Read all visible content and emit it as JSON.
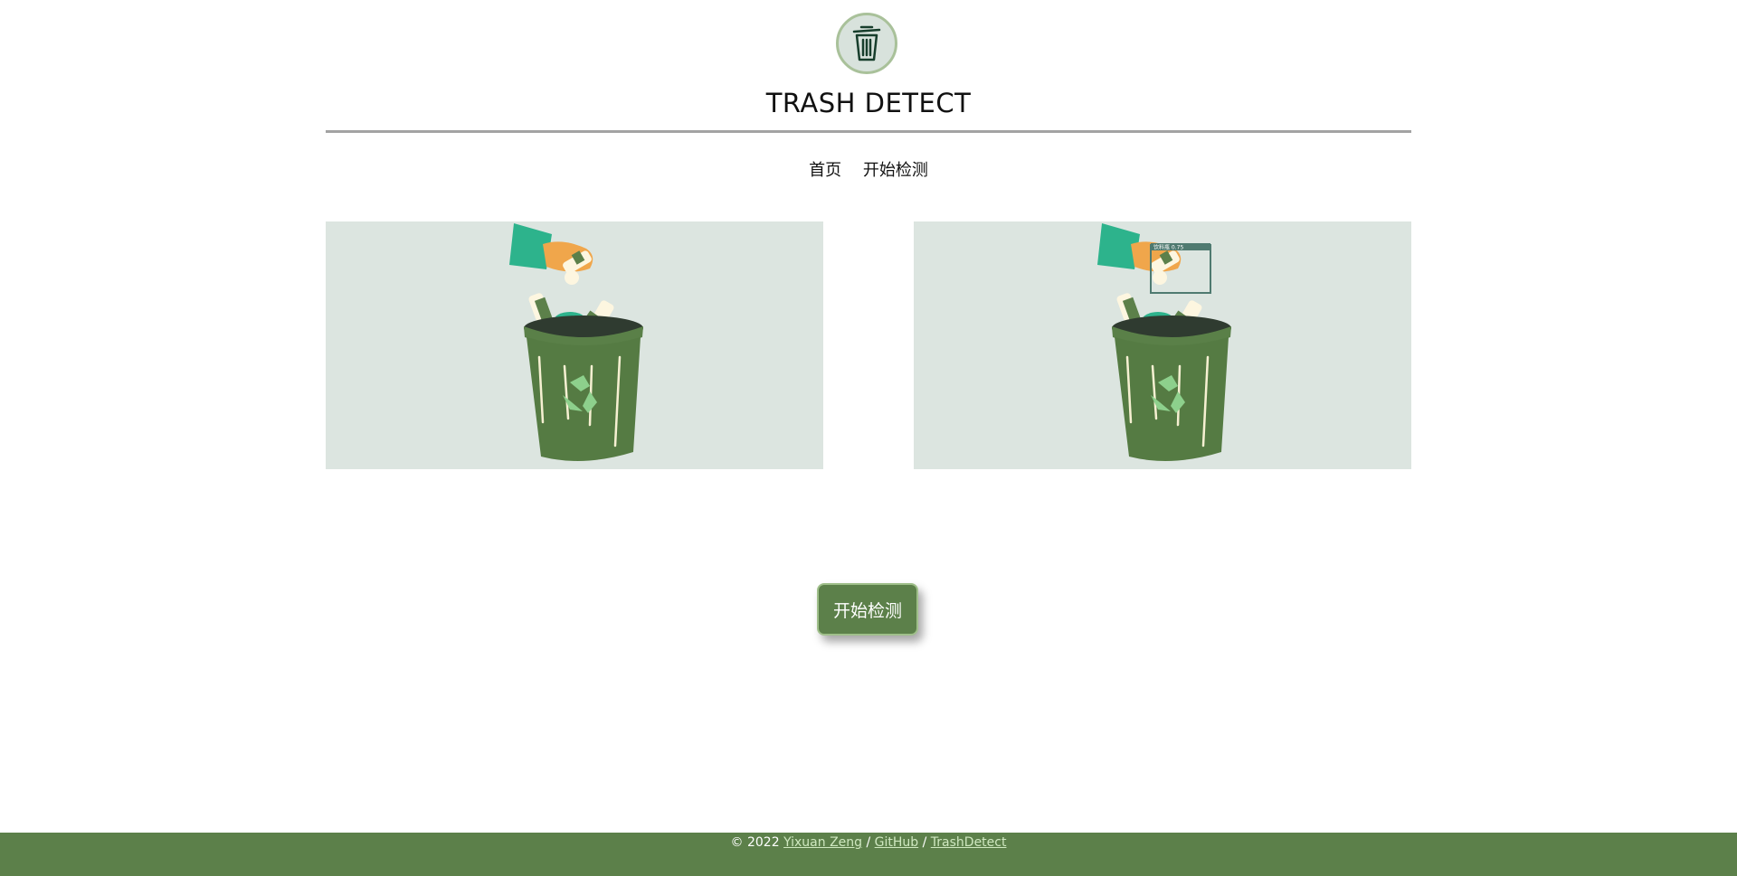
{
  "header": {
    "logo_icon": "trash-bin-icon",
    "title": "TRASH DETECT"
  },
  "nav": {
    "items": [
      {
        "label": "首页"
      },
      {
        "label": "开始检测"
      }
    ]
  },
  "panels": {
    "detection_label": "饮料瓶 0.75"
  },
  "actions": {
    "start_label": "开始检测"
  },
  "footer": {
    "copyright": "© 2022",
    "author": "Yixuan Zeng",
    "sep1": "/",
    "github": "GitHub",
    "sep2": "/",
    "repo": "TrashDetect"
  },
  "colors": {
    "accent_green": "#5c804a",
    "panel_bg": "#dce5e0",
    "divider": "#a3a3a3"
  }
}
